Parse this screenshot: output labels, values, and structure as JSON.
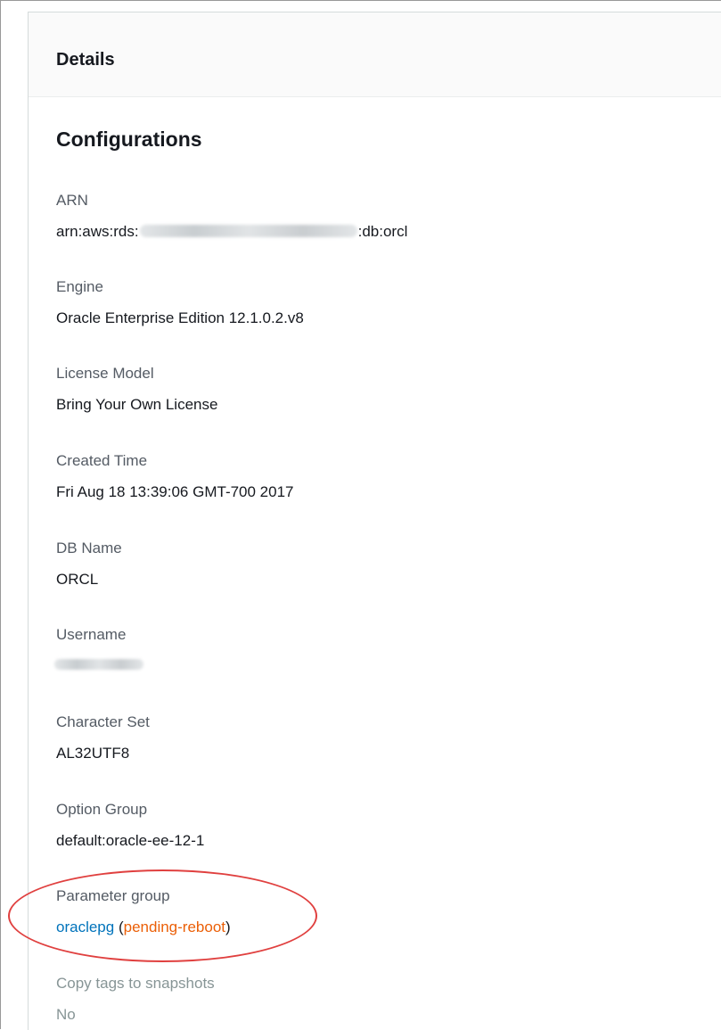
{
  "panel": {
    "title": "Details"
  },
  "section": {
    "title": "Configurations"
  },
  "fields": {
    "arn": {
      "label": "ARN",
      "prefix": "arn:aws:rds:",
      "suffix": ":db:orcl"
    },
    "engine": {
      "label": "Engine",
      "value": "Oracle Enterprise Edition 12.1.0.2.v8"
    },
    "license_model": {
      "label": "License Model",
      "value": "Bring Your Own License"
    },
    "created_time": {
      "label": "Created Time",
      "value": "Fri Aug 18 13:39:06 GMT-700 2017"
    },
    "db_name": {
      "label": "DB Name",
      "value": "ORCL"
    },
    "username": {
      "label": "Username"
    },
    "character_set": {
      "label": "Character Set",
      "value": "AL32UTF8"
    },
    "option_group": {
      "label": "Option Group",
      "value": "default:oracle-ee-12-1"
    },
    "parameter_group": {
      "label": "Parameter group",
      "link": "oraclepg",
      "open_paren": "(",
      "status": "pending-reboot",
      "close_paren": ")"
    },
    "copy_tags": {
      "label": "Copy tags to snapshots",
      "value": "No"
    }
  },
  "colors": {
    "link": "#0073bb",
    "status_warning": "#eb5f07",
    "annotation": "#e0403f"
  }
}
